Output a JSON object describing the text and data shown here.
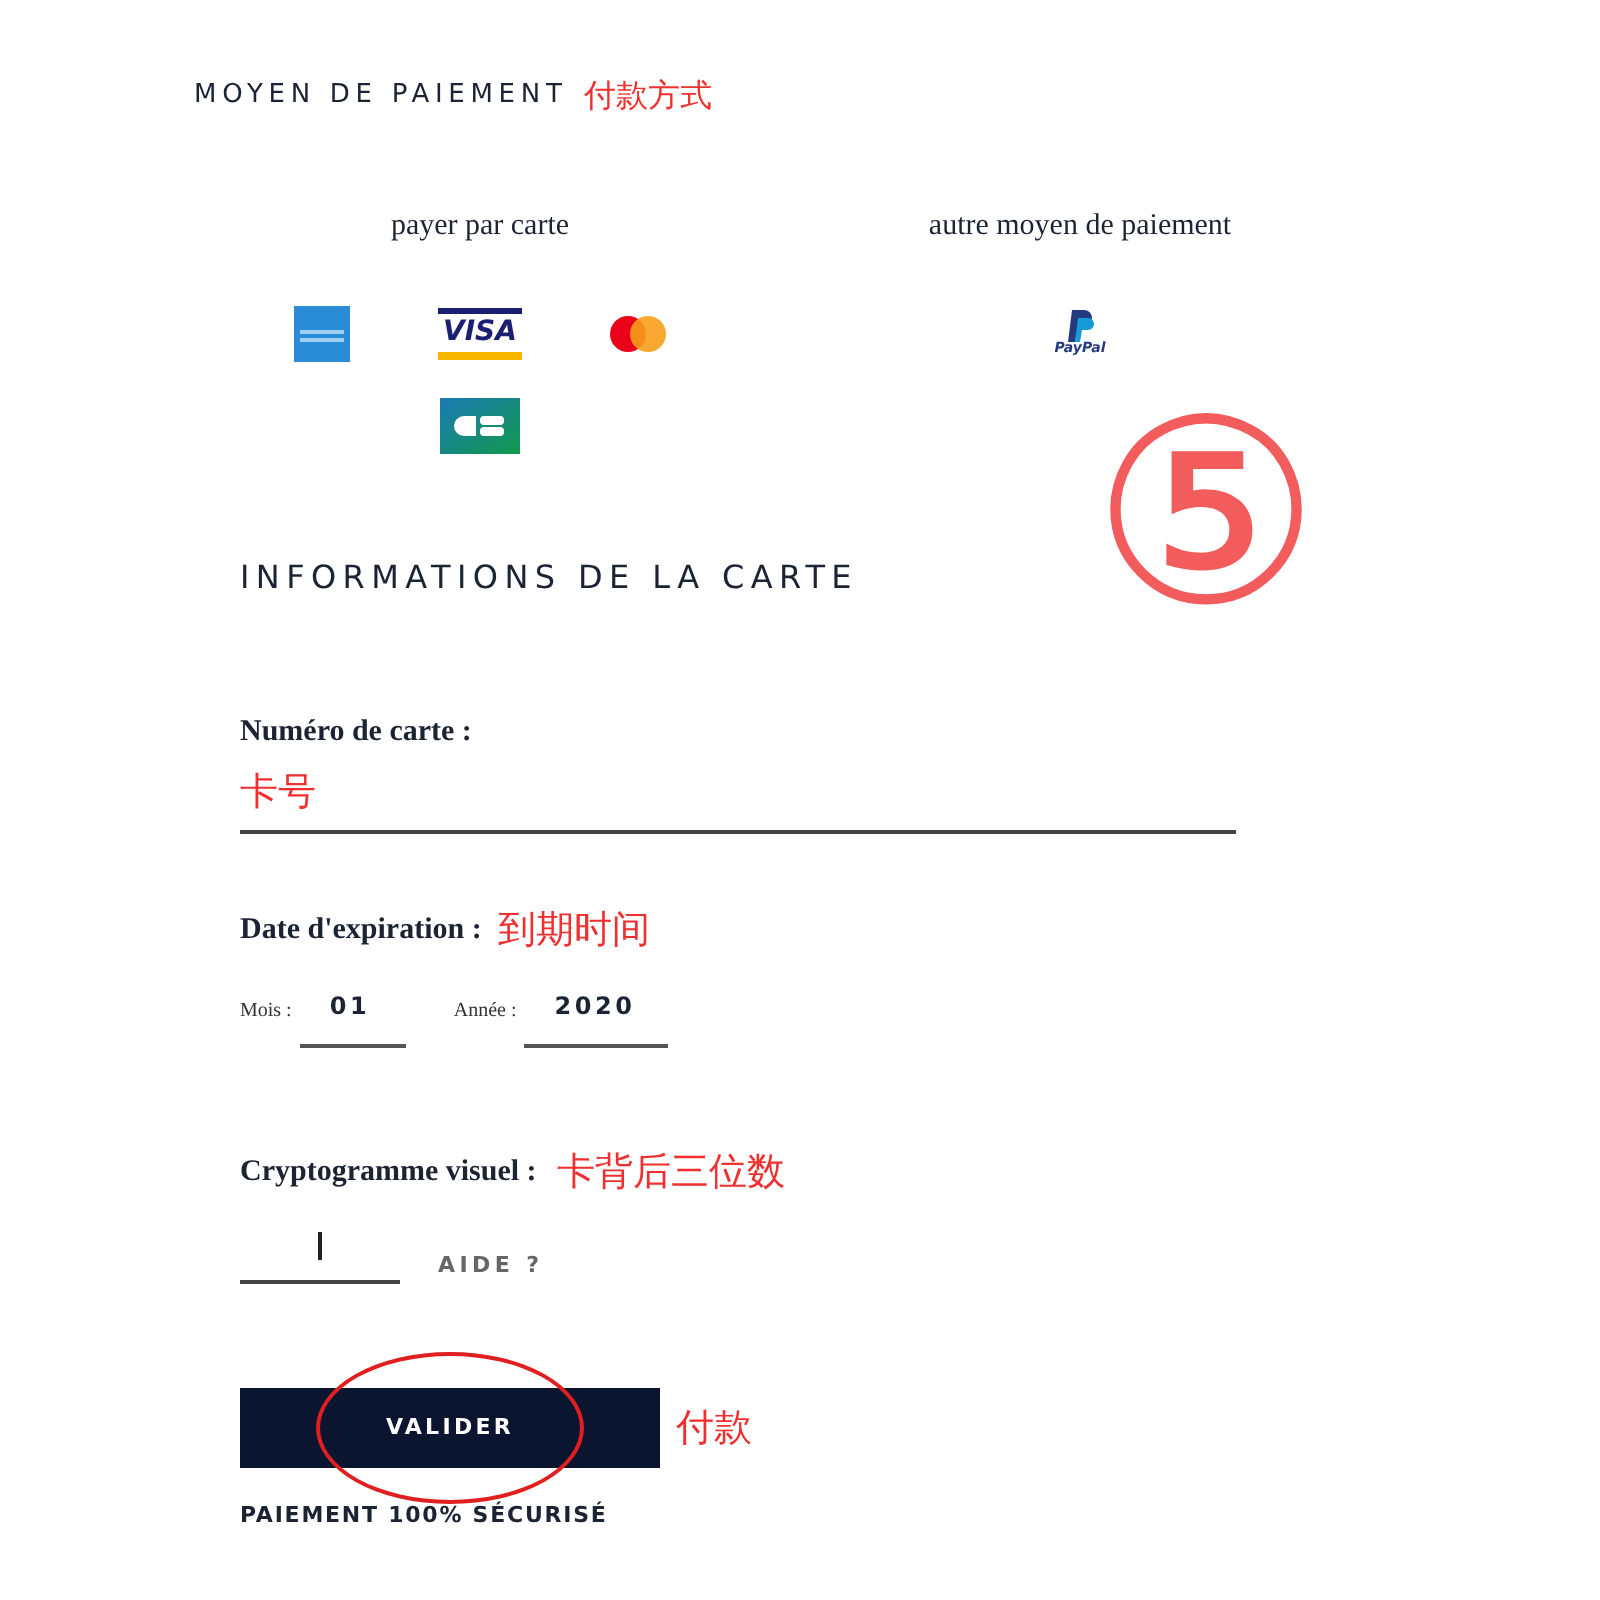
{
  "payment_method": {
    "title": "MOYEN DE PAIEMENT",
    "note": "付款方式",
    "options": [
      {
        "label": "payer par carte",
        "cards": [
          {
            "kind": "amex"
          },
          {
            "kind": "visa",
            "text": "VISA"
          },
          {
            "kind": "mastercard"
          },
          {
            "kind": "cb"
          }
        ]
      },
      {
        "label": "autre moyen de paiement",
        "cards": [
          {
            "kind": "paypal",
            "text": "PayPal"
          }
        ]
      }
    ]
  },
  "step_mark": "⑤",
  "card_info": {
    "title": "INFORMATIONS DE LA CARTE",
    "card_number": {
      "label": "Numéro de carte :",
      "note": "卡号"
    },
    "expiry": {
      "label": "Date d'expiration :",
      "note": "到期时间",
      "month": {
        "label": "Mois :",
        "value": "01"
      },
      "year": {
        "label": "Année :",
        "value": "2020"
      }
    },
    "cvv": {
      "label": "Cryptogramme visuel :",
      "note": "卡背后三位数",
      "help": "AIDE ?"
    },
    "submit": {
      "label": "VALIDER",
      "note": "付款",
      "circled": true
    },
    "footer": "PAIEMENT 100% SÉCURISÉ"
  }
}
